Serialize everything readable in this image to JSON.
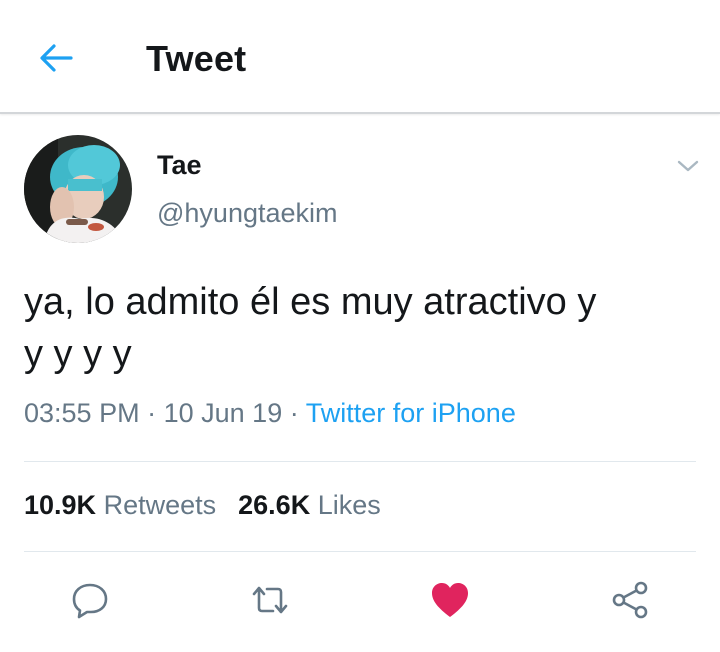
{
  "header": {
    "title": "Tweet",
    "back_icon": "arrow-left-icon",
    "accent": "#1da1f2"
  },
  "author": {
    "name": "Tae",
    "handle": "@hyungtaekim",
    "avatar": "profile-photo",
    "menu_icon": "chevron-down-icon"
  },
  "tweet": {
    "text_line1": "ya, lo admito él es muy atractivo y",
    "text_line2": "y y y y",
    "time": "03:55 PM",
    "separator": "·",
    "date": "10 Jun 19",
    "source": "Twitter for iPhone"
  },
  "stats": {
    "retweets_count": "10.9K",
    "retweets_label": "Retweets",
    "likes_count": "26.6K",
    "likes_label": "Likes"
  },
  "actions": {
    "reply_icon": "reply-icon",
    "retweet_icon": "retweet-icon",
    "like_icon": "heart-icon",
    "share_icon": "share-icon",
    "like_color": "#e0245e",
    "icon_color": "#657786"
  }
}
